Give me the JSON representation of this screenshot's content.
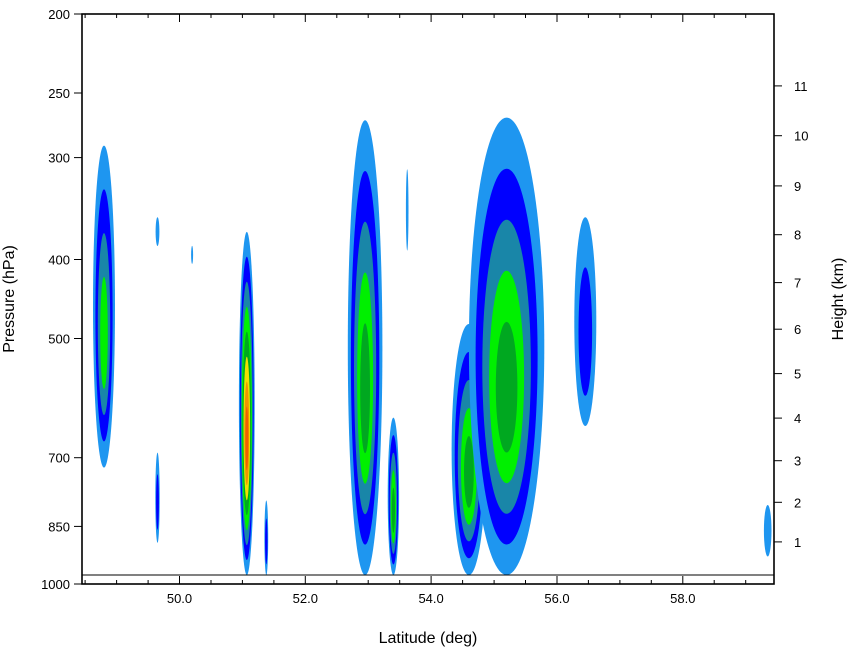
{
  "chart_data": {
    "type": "heatmap",
    "title": "",
    "xlabel": "Latitude (deg)",
    "ylabel": "Pressure (hPa)",
    "y2label": "Height (km)",
    "xlim": [
      48.45,
      59.45
    ],
    "ylim_hpa": [
      200,
      1000
    ],
    "y_scale": "log",
    "x_ticks": [
      "50.0",
      "52.0",
      "54.0",
      "56.0",
      "58.0"
    ],
    "x_tick_values": [
      50,
      52,
      54,
      56,
      58
    ],
    "y_ticks": [
      "200",
      "250",
      "300",
      "400",
      "500",
      "700",
      "850",
      "1000"
    ],
    "y_tick_values": [
      200,
      250,
      300,
      400,
      500,
      700,
      850,
      1000
    ],
    "y2_ticks": [
      "1",
      "2",
      "3",
      "4",
      "5",
      "6",
      "7",
      "8",
      "9",
      "10",
      "11"
    ],
    "y2_tick_values_km": [
      1,
      2,
      3,
      4,
      5,
      6,
      7,
      8,
      9,
      10,
      11
    ],
    "y2_tick_pressure_hpa": [
      888,
      794,
      706,
      626,
      552,
      487,
      427,
      373,
      325,
      282,
      245
    ],
    "grid": false,
    "legend": "none",
    "contour_levels": [
      {
        "level": 1,
        "color": "#1e96f0"
      },
      {
        "level": 2,
        "color": "#0000ff"
      },
      {
        "level": 3,
        "color": "#1986a8"
      },
      {
        "level": 4,
        "color": "#00f000"
      },
      {
        "level": 5,
        "color": "#00a820"
      },
      {
        "level": 6,
        "color": "#f0e000"
      },
      {
        "level": 7,
        "color": "#f09600"
      },
      {
        "level": 8,
        "color": "#f06000"
      }
    ],
    "cells": [
      {
        "lat": 48.8,
        "lon_width": 0.35,
        "p_top": 290,
        "p_bot": 720,
        "levels": [
          1,
          2,
          3,
          4
        ]
      },
      {
        "lat": 49.65,
        "lon_width": 0.06,
        "p_top": 355,
        "p_bot": 385,
        "levels": [
          1
        ]
      },
      {
        "lat": 49.65,
        "lon_width": 0.07,
        "p_top": 690,
        "p_bot": 890,
        "levels": [
          1,
          2
        ]
      },
      {
        "lat": 50.2,
        "lon_width": 0.02,
        "p_top": 385,
        "p_bot": 405,
        "levels": [
          1
        ]
      },
      {
        "lat": 51.07,
        "lon_width": 0.25,
        "p_top": 370,
        "p_bot": 975,
        "levels": [
          1,
          2,
          3,
          4,
          5,
          6,
          7,
          8
        ]
      },
      {
        "lat": 51.38,
        "lon_width": 0.06,
        "p_top": 790,
        "p_bot": 975,
        "levels": [
          1,
          2
        ]
      },
      {
        "lat": 52.95,
        "lon_width": 0.55,
        "p_top": 270,
        "p_bot": 975,
        "levels": [
          1,
          2,
          3,
          4,
          5
        ]
      },
      {
        "lat": 53.4,
        "lon_width": 0.18,
        "p_top": 625,
        "p_bot": 975,
        "levels": [
          1,
          2,
          3,
          4,
          5
        ]
      },
      {
        "lat": 53.62,
        "lon_width": 0.04,
        "p_top": 310,
        "p_bot": 390,
        "levels": [
          1
        ]
      },
      {
        "lat": 54.6,
        "lon_width": 0.55,
        "p_top": 480,
        "p_bot": 975,
        "levels": [
          1,
          2,
          3,
          4,
          5
        ]
      },
      {
        "lat": 55.2,
        "lon_width": 1.2,
        "p_top": 268,
        "p_bot": 975,
        "levels": [
          1,
          2,
          3,
          4,
          5
        ]
      },
      {
        "lat": 56.45,
        "lon_width": 0.35,
        "p_top": 355,
        "p_bot": 640,
        "levels": [
          1,
          2
        ]
      },
      {
        "lat": 59.35,
        "lon_width": 0.12,
        "p_top": 800,
        "p_bot": 925,
        "levels": [
          1
        ]
      }
    ],
    "terrain_pressure_hpa": 975
  }
}
